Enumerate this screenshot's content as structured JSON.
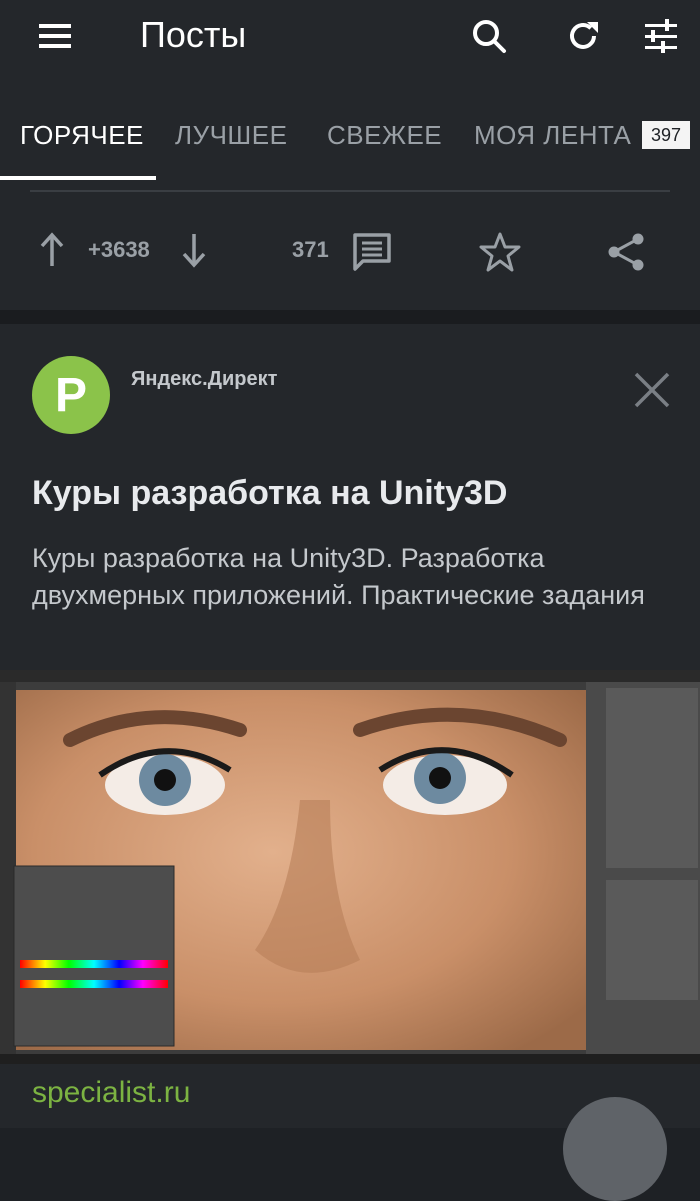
{
  "header": {
    "title": "Посты",
    "icons": [
      "menu-icon",
      "search-icon",
      "refresh-icon",
      "filter-icon"
    ]
  },
  "tabs": [
    {
      "label": "ГОРЯЧЕЕ",
      "active": true
    },
    {
      "label": "ЛУЧШЕЕ",
      "active": false
    },
    {
      "label": "СВЕЖЕЕ",
      "active": false
    },
    {
      "label": "МОЯ ЛЕНТА",
      "active": false,
      "badge": "397"
    }
  ],
  "post_actions": {
    "rating": "+3638",
    "comments": "371",
    "icons": [
      "arrow-up-icon",
      "arrow-down-icon",
      "comment-icon",
      "star-icon",
      "share-icon"
    ]
  },
  "ad": {
    "avatar_letter": "P",
    "advertiser": "Яндекс.Директ",
    "title": "Куры разработка на Unity3D",
    "text": "Куры разработка на Unity3D. Разработка двухмерных приложений. Практические задания",
    "domain": "specialist.ru"
  },
  "colors": {
    "background": "#1e2125",
    "surface": "#24272b",
    "accent_green": "#7cb342",
    "avatar_green": "#8bc34a",
    "text_primary": "#ffffff",
    "text_secondary": "#9aa0a6"
  }
}
